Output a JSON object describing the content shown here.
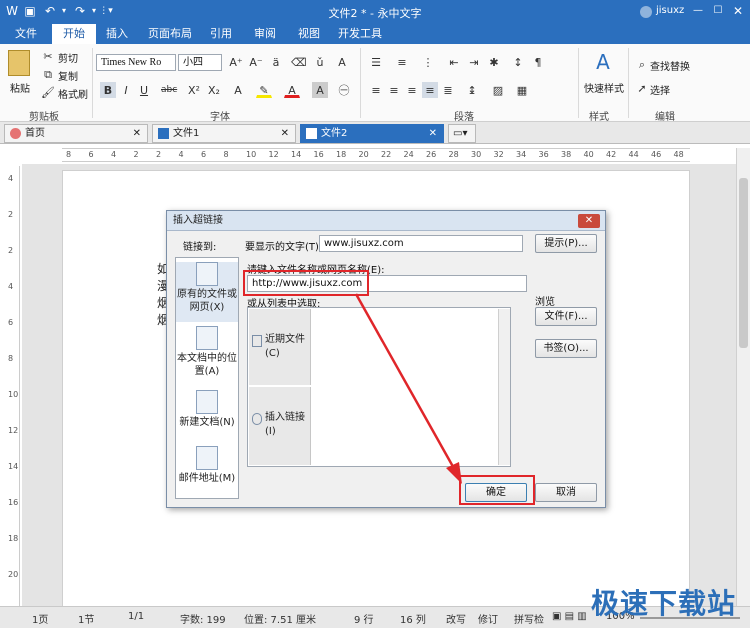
{
  "window": {
    "title": "文件2 * - 永中文字",
    "user": "jisuxz"
  },
  "menu": [
    "文件",
    "开始",
    "插入",
    "页面布局",
    "引用",
    "审阅",
    "视图",
    "开发工具"
  ],
  "ribbon": {
    "paste": "粘贴",
    "cut": "剪切",
    "copy": "复制",
    "format_painter": "格式刷",
    "font_name": "Times New Ro",
    "font_size": "小四",
    "quick_style": "快速样式",
    "find_replace": "查找替换",
    "select": "选择",
    "groups": {
      "clipboard": "剪贴板",
      "font": "字体",
      "paragraph": "段落",
      "style": "样式",
      "edit": "编辑"
    }
  },
  "tabs": [
    {
      "label": "首页"
    },
    {
      "label": "文件1"
    },
    {
      "label": "文件2"
    }
  ],
  "ruler_h": [
    "8",
    "6",
    "4",
    "2",
    "2",
    "4",
    "6",
    "8",
    "10",
    "12",
    "14",
    "16",
    "18",
    "20",
    "22",
    "24",
    "26",
    "28",
    "30",
    "32",
    "34",
    "36",
    "38",
    "40",
    "42",
    "44",
    "46",
    "48"
  ],
  "ruler_v": [
    "4",
    "2",
    "2",
    "4",
    "6",
    "8",
    "10",
    "12",
    "14",
    "16",
    "18",
    "20"
  ],
  "doc_text": [
    "如",
    "漫",
    "烟",
    "烟"
  ],
  "dialog": {
    "title": "插入超链接",
    "link_to": "链接到:",
    "display_label": "要显示的文字(T):",
    "display_value": "www.jisuxz.com",
    "tip_btn": "提示(P)...",
    "address_label": "请键入文件名称或网页名称(E):",
    "address_value": "http://www.jisuxz.com",
    "browse": "浏览",
    "file_btn": "文件(F)...",
    "list_label": "或从列表中选取:",
    "recent": "近期文件(C)",
    "inserted": "插入链接(I)",
    "bookmark_btn": "书签(O)...",
    "ok": "确定",
    "cancel": "取消",
    "link_options": [
      "原有的文件或网页(X)",
      "本文档中的位置(A)",
      "新建文档(N)",
      "邮件地址(M)"
    ]
  },
  "status": {
    "page": "1页",
    "section": "1节",
    "pages": "1/1",
    "words": "字数: 199",
    "position": "位置: 7.51 厘米",
    "row": "9 行",
    "col": "16 列",
    "overwrite": "改写",
    "revise": "修订",
    "spell": "拼写检",
    "zoom": "100%"
  },
  "watermark": "极速下载站",
  "colors": {
    "brand": "#2b6fbe",
    "highlight": "#e0262a"
  }
}
